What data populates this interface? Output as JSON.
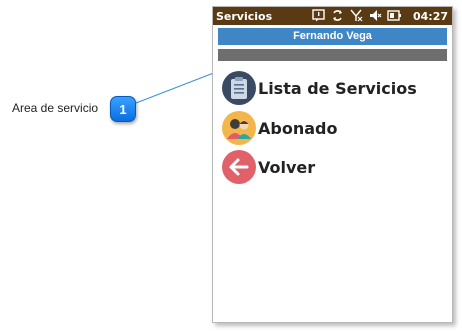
{
  "callout": {
    "label": "Area de servicio",
    "number": "1"
  },
  "statusbar": {
    "title": "Servicios",
    "time": "04:27",
    "icons": [
      "message-icon",
      "sync-icon",
      "no-signal-icon",
      "volume-mute-icon",
      "battery-icon"
    ]
  },
  "header": {
    "user_name": "Fernando Vega"
  },
  "menu": {
    "items": [
      {
        "label": "Lista de Servicios",
        "icon": "clipboard-icon",
        "color": "#3b4a63"
      },
      {
        "label": "Abonado",
        "icon": "people-icon",
        "color": "#f3b64a"
      },
      {
        "label": "Volver",
        "icon": "back-arrow-icon",
        "color": "#e0616a"
      }
    ]
  },
  "colors": {
    "statusbar": "#5a3a13",
    "userbar": "#3f86c6",
    "graybar": "#6e6e6e",
    "badge": "#1a82f0"
  }
}
